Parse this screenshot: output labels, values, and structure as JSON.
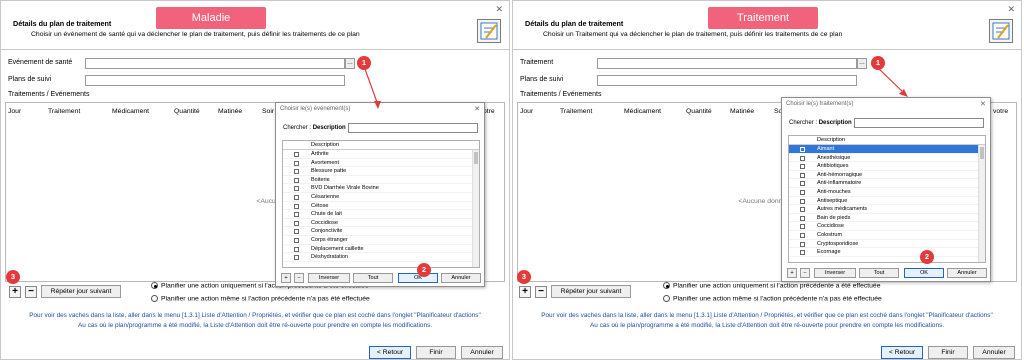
{
  "left": {
    "tag": "Maladie",
    "title": "Détails du plan de traitement",
    "subtitle": "Choisir un événement de santé qui va déclencher le plan de traitement, puis définir les traitements de ce plan",
    "field1_label": "Evénement de santé",
    "field2_label": "Plans de suivi",
    "section": "Traitements / Evénements",
    "columns": [
      "Jour",
      "Traitement",
      "Médicament",
      "Quantité",
      "Matinée",
      "Soir"
    ],
    "empty": "<Aucune donnée à",
    "col_tail": "ptre",
    "popup": {
      "title": "Choisir le(s) événement(s)",
      "search_prefix": "Chercher :",
      "search_field": "Description",
      "header": "Description",
      "items": [
        "Arthrite",
        "Avortement",
        "Blessure patte",
        "Boiterie",
        "BVD Diarrhée Virale Bovine",
        "Césarienne",
        "Cétose",
        "Chute de lait",
        "Coccidiose",
        "Conjonctivite",
        "Corps étranger",
        "Déplacement caillette",
        "Déshydratation"
      ],
      "selected": -1,
      "buttons": [
        "Inverser",
        "Tout",
        "OK",
        "Annuler"
      ]
    }
  },
  "right": {
    "tag": "Traitement",
    "title": "Détails du plan de traitement",
    "subtitle": "Choisir un Traitement qui va déclencher le plan de traitement, puis définir les traitements de ce plan",
    "field1_label": "Traitement",
    "field2_label": "Plans de suivi",
    "section": "Traitements / Evénements",
    "columns": [
      "Jour",
      "Traitement",
      "Médicament",
      "Quantité",
      "Matinée",
      "Soir"
    ],
    "empty": "<Aucune donnée à",
    "col_tail": "votre",
    "popup": {
      "title": "Choisir le(s) traitement(s)",
      "search_prefix": "Chercher :",
      "search_field": "Description",
      "header": "Description",
      "items": [
        "Aimant",
        "Anesthésique",
        "Antibiotiques",
        "Anti-hémorragique",
        "Anti-inflammatoire",
        "Anti-mouches",
        "Antiseptique",
        "Autres médicaments",
        "Bain de pieds",
        "Coccidiose",
        "Colostrum",
        "Cryptosporidiose",
        "Ecornage"
      ],
      "selected": 0,
      "buttons": [
        "Inverser",
        "Tout",
        "OK",
        "Annuler"
      ]
    }
  },
  "common": {
    "plus": "+",
    "minus": "−",
    "repeat": "Répéter jour suivant",
    "radio1": "Planifier une action uniquement si l'action précédente a été effectuée",
    "radio2": "Planifier une action même si l'action précédente n'a pas été effectuée",
    "info1": "Pour voir des vaches dans la liste, aller dans le menu [1.3.1] Liste d'Attention / Propriétés, et vérifier que ce plan est coché dans l'onglet \"Planificateur d'actions\"",
    "info2": "Au cas où le plan/programme a été modifié, la Liste d'Attention doit être ré-ouverte pour prendre en compte les modifications.",
    "back": "< Retour",
    "finish": "Finir",
    "cancel": "Annuler",
    "badges": [
      "1",
      "2",
      "3"
    ],
    "radio_selected": 1
  },
  "colors": {
    "tag_bg": "#f0637a",
    "badge": "#e23b3b",
    "link": "#1f4bb0",
    "select": "#3078d8"
  }
}
